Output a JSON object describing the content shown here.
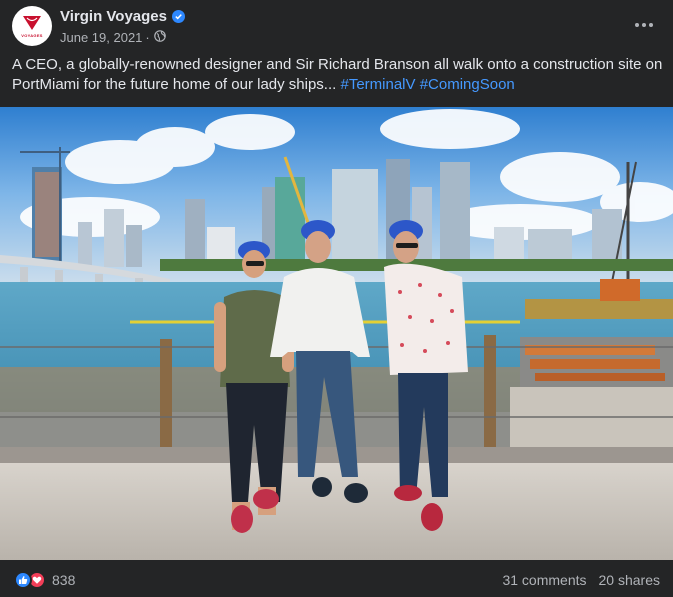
{
  "post": {
    "page_name": "Virgin Voyages",
    "avatar_text": "VOYAGES",
    "date": "June 19, 2021",
    "audience_icon": "globe-icon",
    "verified_icon": "verified-badge-icon",
    "more_icon": "more-options-icon",
    "caption_text": "A CEO, a globally-renowned designer and Sir Richard Branson all walk onto a construction site on PortMiami for the future home of our lady ships... ",
    "hashtags": [
      "#TerminalV",
      "#ComingSoon"
    ]
  },
  "photo": {
    "subject": "three-people-in-hard-hats-at-construction-site"
  },
  "footer": {
    "reaction_icons": [
      "like-icon",
      "love-icon"
    ],
    "reaction_count": "838",
    "comments": "31 comments",
    "shares": "20 shares"
  },
  "colors": {
    "background": "#242526",
    "text_primary": "#e4e6eb",
    "text_secondary": "#b0b3b8",
    "hashtag": "#4599ff",
    "verified": "#2d88ff",
    "brand_red": "#c8102e"
  }
}
